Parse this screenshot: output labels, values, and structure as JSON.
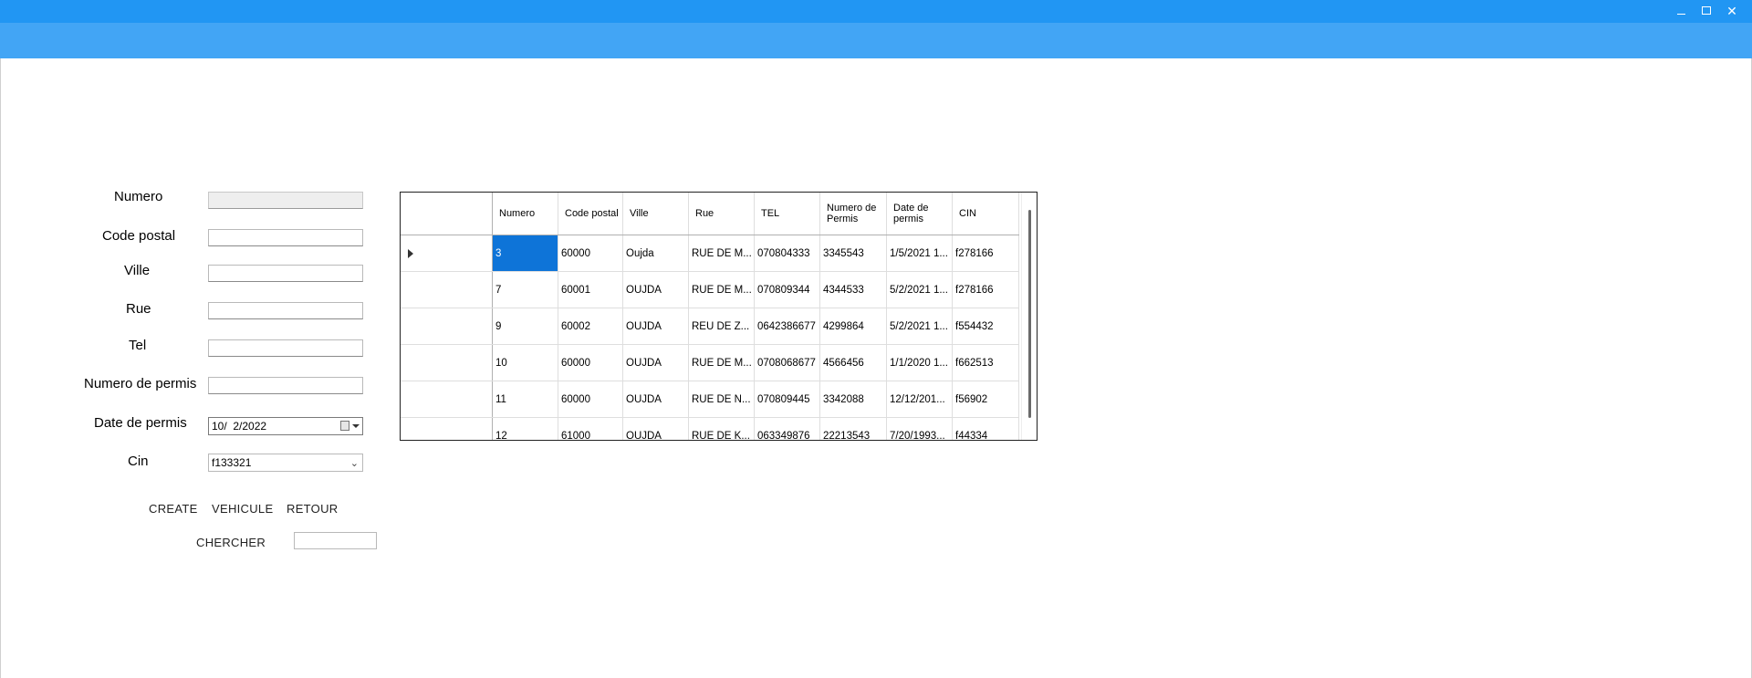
{
  "window": {
    "controls": {
      "minimize": "–",
      "maximize": "□",
      "close": "✕"
    }
  },
  "form": {
    "numero": {
      "label": "Numero",
      "value": ""
    },
    "code_postal": {
      "label": "Code postal",
      "value": ""
    },
    "ville": {
      "label": "Ville",
      "value": ""
    },
    "rue": {
      "label": "Rue",
      "value": ""
    },
    "tel": {
      "label": "Tel",
      "value": ""
    },
    "numero_permis": {
      "label": "Numero de permis",
      "value": ""
    },
    "date_permis": {
      "label": "Date de permis",
      "value": "10/  2/2022"
    },
    "cin": {
      "label": "Cin",
      "value": "f133321"
    }
  },
  "buttons": {
    "create": "CREATE",
    "vehicule": "VEHICULE",
    "retour": "RETOUR",
    "chercher": "CHERCHER"
  },
  "search": {
    "value": ""
  },
  "table": {
    "columns": [
      "Numero",
      "Code postal",
      "Ville",
      "Rue",
      "TEL",
      "Numero de Permis",
      "Date de permis",
      "CIN"
    ],
    "rows": [
      [
        "3",
        "60000",
        "Oujda",
        "RUE DE M...",
        "070804333",
        "3345543",
        "1/5/2021 1...",
        "f278166"
      ],
      [
        "7",
        "60001",
        "OUJDA",
        "RUE DE M...",
        "070809344",
        "4344533",
        "5/2/2021 1...",
        "f278166"
      ],
      [
        "9",
        "60002",
        "OUJDA",
        "REU DE Z...",
        "0642386677",
        "4299864",
        "5/2/2021 1...",
        "f554432"
      ],
      [
        "10",
        "60000",
        "OUJDA",
        "RUE DE M...",
        "0708068677",
        "4566456",
        "1/1/2020 1...",
        "f662513"
      ],
      [
        "11",
        "60000",
        "OUJDA",
        "RUE DE N...",
        "070809445",
        "3342088",
        "12/12/201...",
        "f56902"
      ],
      [
        "12",
        "61000",
        "OUJDA",
        "RUE DE K...",
        "063349876",
        "22213543",
        "7/20/1993...",
        "f44334"
      ]
    ],
    "selected_row": 0,
    "selected_col": 0
  },
  "colors": {
    "titlebar": "#2196f3",
    "appbar": "#42a5f5",
    "selection": "#0e74d8"
  }
}
